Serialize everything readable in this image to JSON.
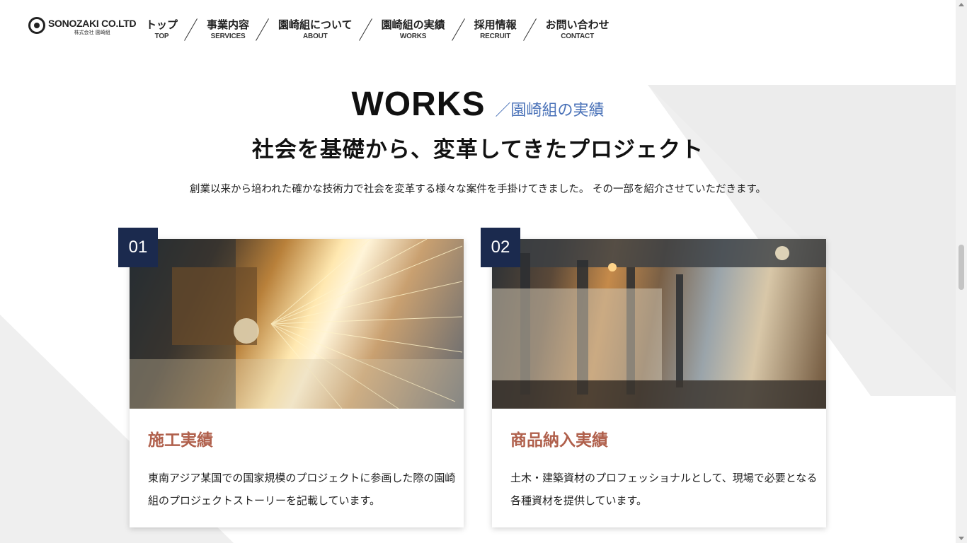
{
  "brand": {
    "name_en": "SONOZAKI CO.LTD",
    "name_jp": "株式会社 園崎組",
    "logo_icon": "gear-logo-icon"
  },
  "nav": [
    {
      "jp": "トップ",
      "en": "TOP"
    },
    {
      "jp": "事業内容",
      "en": "SERVICES"
    },
    {
      "jp": "園崎組について",
      "en": "ABOUT"
    },
    {
      "jp": "園崎組の実績",
      "en": "WORKS"
    },
    {
      "jp": "採用情報",
      "en": "RECRUIT"
    },
    {
      "jp": "お問い合わせ",
      "en": "CONTACT"
    }
  ],
  "section": {
    "title": "WORKS",
    "subtitle": "／園崎組の実績",
    "headline": "社会を基礎から、変革してきたプロジェクト",
    "lead": "創業以来から培われた確かな技術力で社会を変革する様々な案件を手掛けてきました。 その一部を紹介させていただきます。"
  },
  "cards": [
    {
      "number": "01",
      "title": "施工実績",
      "text": "東南アジア某国での国家規模のプロジェクトに参画した際の園崎組のプロジェクトストーリーを記載しています。",
      "image": "welding-sparks-photo"
    },
    {
      "number": "02",
      "title": "商品納入実績",
      "text": "土木・建築資材のプロフェッショナルとして、現場で必要となる各種資材を提供しています。",
      "image": "steel-factory-photo"
    }
  ],
  "colors": {
    "accent_blue": "#4a72b8",
    "badge_navy": "#1b2a4e",
    "card_title": "#b0604c"
  }
}
